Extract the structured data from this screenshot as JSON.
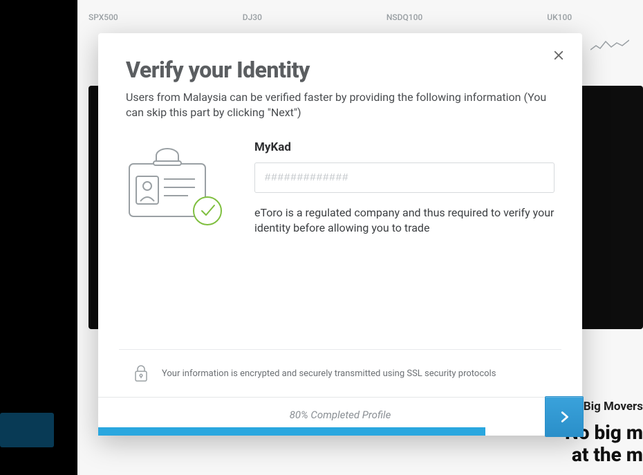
{
  "background": {
    "tickers": [
      "SPX500",
      "DJ30",
      "NSDQ100",
      "UK100"
    ],
    "side_title": "Big Movers",
    "side_big_line1": "No big m",
    "side_big_line2": "at the m"
  },
  "modal": {
    "title": "Verify your Identity",
    "subtitle": "Users from Malaysia can be verified faster by providing the following information (You can skip this part by clicking \"Next\")",
    "field_label": "MyKad",
    "field_placeholder": "#############",
    "helper": "eToro is a regulated company and thus required to verify your identity before allowing you to trade",
    "security_text": "Your information is encrypted and securely transmitted using SSL security protocols",
    "progress_pct": 80,
    "progress_label": "80% Completed Profile"
  },
  "colors": {
    "accent": "#2aa7df",
    "title_gray": "#5b5e61"
  }
}
